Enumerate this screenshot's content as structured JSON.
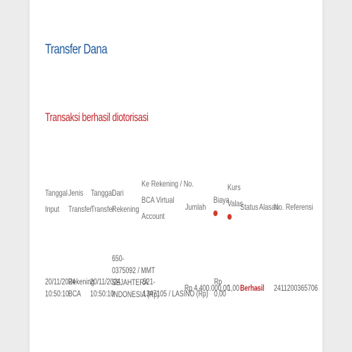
{
  "page": {
    "title": "Transfer Dana",
    "success_message": "Transaksi berhasil diotorisasi"
  },
  "table": {
    "headers": {
      "tanggal_input": [
        "Tanggal",
        "Input"
      ],
      "jenis_transfer": [
        "Jenis",
        "Transfer"
      ],
      "tanggal_transfer": [
        "Tanggal",
        "Transfer"
      ],
      "dari_rekening": [
        "Dari",
        "Rekening"
      ],
      "ke_rekening": [
        "Ke Rekening / No.",
        "BCA Virtual",
        "Account"
      ],
      "jumlah": "Jumlah",
      "biaya": "Biaya",
      "kurs_valas": [
        "Kurs",
        "Valas"
      ],
      "status": "Status",
      "alasan": "Alasan",
      "no_referensi": "No. Referensi"
    },
    "row": {
      "tanggal_input": [
        "20/11/2024",
        "10:50:10"
      ],
      "jenis_transfer": [
        "Rekening",
        "BCA"
      ],
      "tanggal_transfer": [
        "20/11/2024",
        "10:50:10"
      ],
      "dari_rekening": [
        "650-",
        "0375092 / MMT",
        "SEJAHTERA",
        "INDONESIA (Rp)"
      ],
      "ke_rekening": [
        "521-",
        "1347105 / LASINO (Rp)"
      ],
      "jumlah": "Rp 4.400.000,00",
      "biaya": [
        "Rp",
        "0,00"
      ],
      "kurs_valas": "1,00",
      "status": "Berhasil",
      "alasan": "-",
      "no_referensi": "2411200365706"
    },
    "colors": {
      "status_success": "#c1272d",
      "title": "#1f5a9c",
      "info_badge": "#d23b2b"
    },
    "icons": {
      "biaya_info": "info-icon",
      "kurs_info": "info-icon"
    }
  }
}
